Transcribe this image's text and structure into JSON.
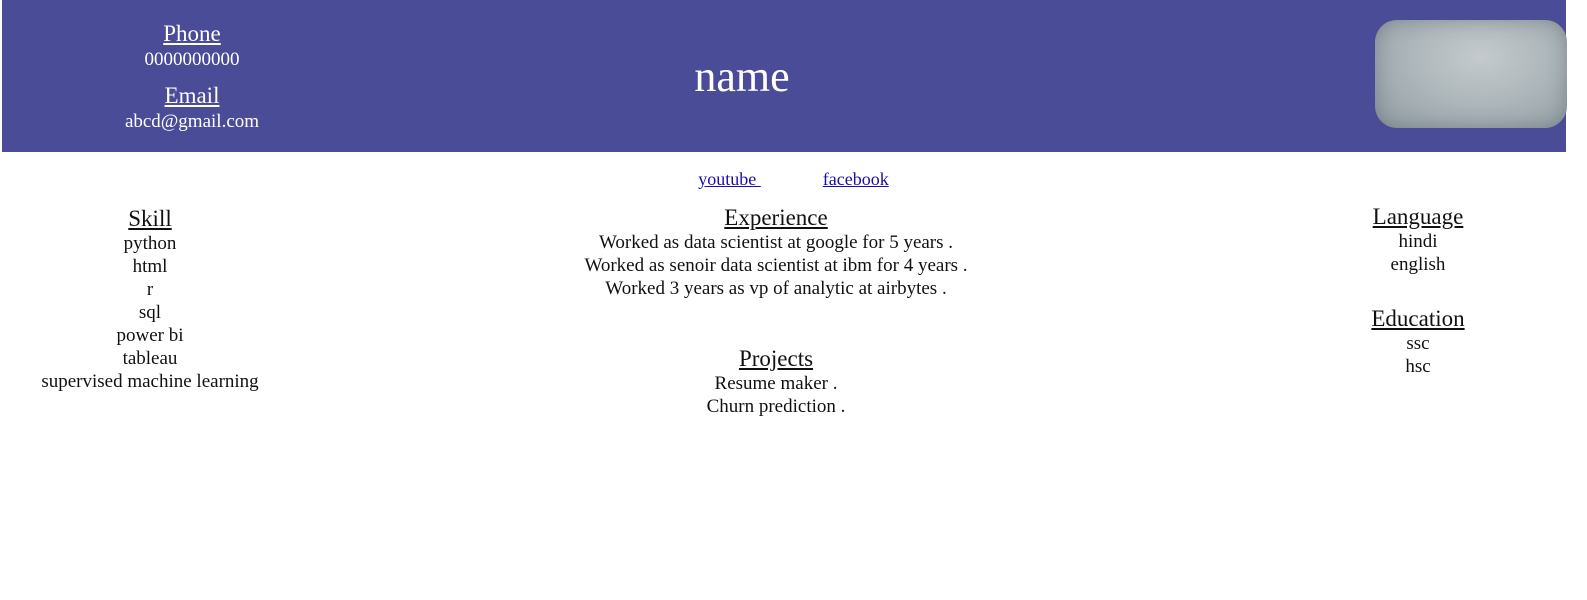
{
  "header": {
    "phone_label": "Phone",
    "phone_value": "0000000000",
    "email_label": "Email",
    "email_value": "abcd@gmail.com",
    "name": "name",
    "background_color": "#4b4c97"
  },
  "links": {
    "youtube": "youtube ",
    "facebook": "facebook"
  },
  "skill": {
    "title": "Skill",
    "items": [
      "python",
      "html",
      "r",
      "sql",
      "power bi",
      "tableau",
      "supervised machine learning"
    ]
  },
  "experience": {
    "title": "Experience",
    "items": [
      "Worked as data scientist at google for 5 years .",
      "Worked as senoir data scientist at ibm for 4 years .",
      "Worked 3 years as vp of analytic at airbytes ."
    ]
  },
  "projects": {
    "title": "Projects",
    "items": [
      "Resume maker .",
      "Churn prediction ."
    ]
  },
  "language": {
    "title": "Language",
    "items": [
      "hindi",
      "english"
    ]
  },
  "education": {
    "title": "Education",
    "items": [
      "ssc",
      "hsc"
    ]
  }
}
